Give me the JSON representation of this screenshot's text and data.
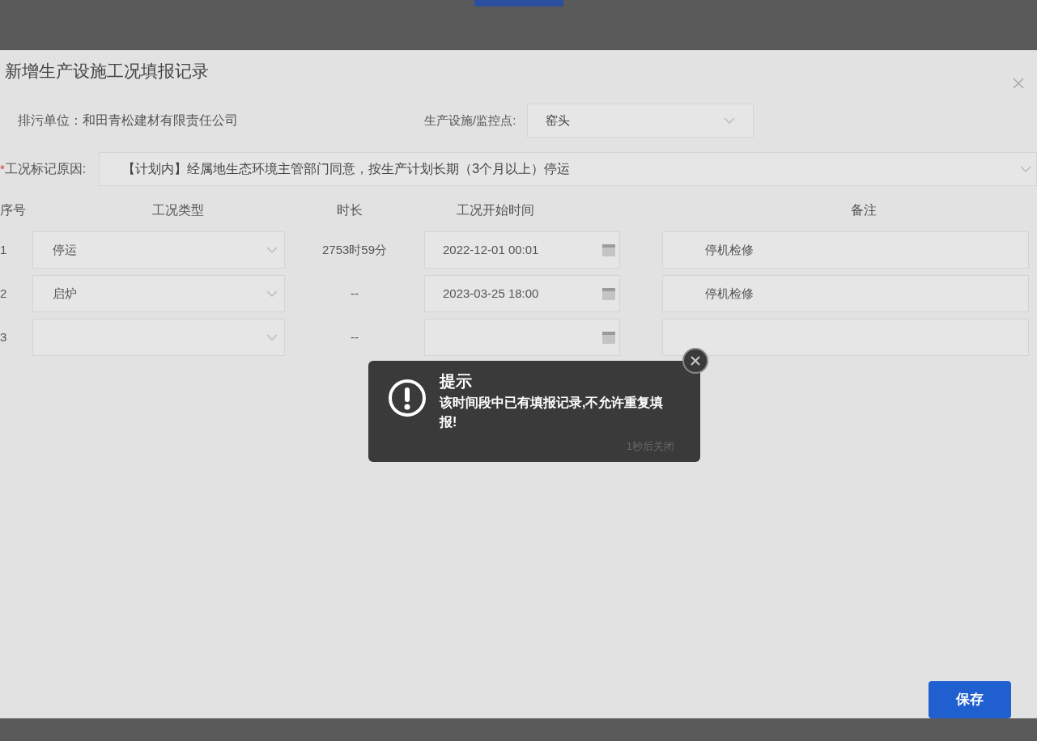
{
  "dialog": {
    "title": "新增生产设施工况填报记录",
    "unit": {
      "label": "排污单位：",
      "value": "和田青松建材有限责任公司"
    },
    "facility": {
      "label": "生产设施/监控点:",
      "value": "窑头"
    },
    "reason": {
      "label": "工况标记原因:",
      "required": true,
      "required_mark": "*",
      "value": "【计划内】经属地生态环境主管部门同意，按生产计划长期（3个月以上）停运"
    },
    "table": {
      "columns": [
        "序号",
        "工况类型",
        "时长",
        "工况开始时间",
        "备注"
      ],
      "rows": [
        {
          "index": "1",
          "type": "停运",
          "duration": "2753时59分",
          "start": "2022-12-01 00:01",
          "remark": "停机检修"
        },
        {
          "index": "2",
          "type": "启炉",
          "duration": "--",
          "start": "2023-03-25 18:00",
          "remark": "停机检修"
        },
        {
          "index": "3",
          "duration": "--"
        }
      ]
    },
    "save_button": "保存"
  },
  "toast": {
    "title": "提示",
    "message": "该时间段中已有填报记录,不允许重复填报!",
    "countdown": "1秒后关闭"
  }
}
